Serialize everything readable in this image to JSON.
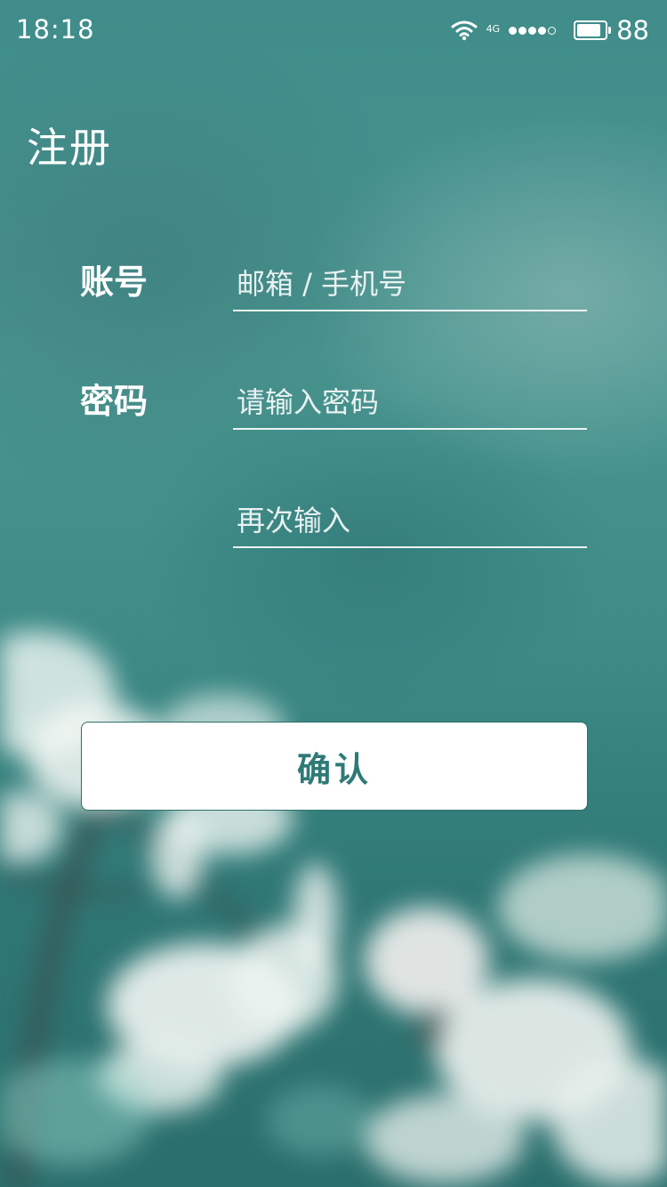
{
  "status_bar": {
    "time": "18:18",
    "network": "4G",
    "battery_level": "88"
  },
  "page": {
    "title": "注册"
  },
  "form": {
    "account_label": "账号",
    "account_placeholder": "邮箱 / 手机号",
    "password_label": "密码",
    "password_placeholder": "请输入密码",
    "confirm_password_placeholder": "再次输入",
    "confirm_button_label": "确认"
  },
  "colors": {
    "background": "#3f8c8a",
    "button_text": "#2e7a76",
    "text": "#ffffff"
  },
  "icons": [
    "wifi-icon",
    "signal-icon",
    "battery-icon"
  ]
}
